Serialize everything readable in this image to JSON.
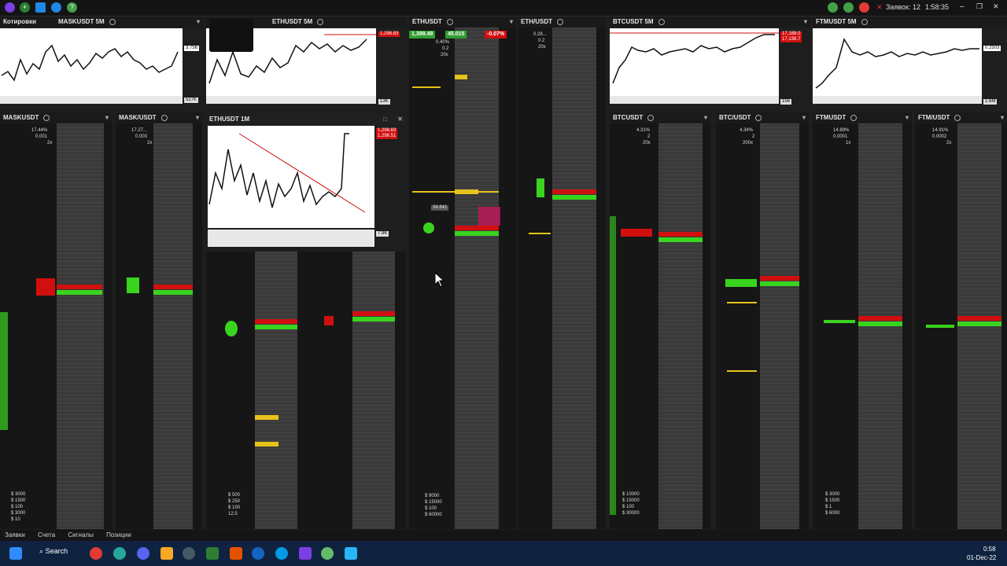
{
  "topbar": {
    "orders_label": "Заявок: 12",
    "time": "1:58:35"
  },
  "quotes_label": "Котировки",
  "charts_top": [
    {
      "title": "MASKUSDT 5M",
      "price_tag": "3.756",
      "vol_tag": "527K"
    },
    {
      "title": "ETHUSDT 5M",
      "price_tag": "1,298.83",
      "vol_tag": "13K"
    },
    {
      "title": "BTCUSDT 5M",
      "price_tag": "17,188.0",
      "price_tag2": "17,138.7",
      "vol_tag": "156"
    },
    {
      "title": "FTMUSDT 5M",
      "price_tag": "0.2503",
      "vol_tag": "1.6M"
    }
  ],
  "floating_chart": {
    "title": "ETHUSDT 1M",
    "price_tag": "1,298.83",
    "price_tag2": "1,298.51",
    "vol_tag": "7.9K"
  },
  "ladders": [
    {
      "title": "MASKUSDT",
      "pct": "17.44%",
      "tick": "0.001",
      "lev": "2x"
    },
    {
      "title": "MASK/USDT",
      "pct": "17.27...",
      "tick": "0.003",
      "lev": "2x"
    },
    {
      "title": "ETHUSDT",
      "pct": "0.40%",
      "tick": "0.2",
      "lev": "20x",
      "bid": "1,399.48",
      "ask": "45.015",
      "change": "-0.07%"
    },
    {
      "title": "ETH/USDT",
      "pct": "0.28...",
      "tick": "0.2",
      "lev": "20x"
    },
    {
      "title": "BTCUSDT",
      "pct": "4.31%",
      "tick": "2",
      "lev": "20x"
    },
    {
      "title": "BTC/USDT",
      "pct": "4.34%",
      "tick": "2",
      "lev": "200x"
    },
    {
      "title": "FTMUSDT",
      "pct": "14.89%",
      "tick": "0.0001",
      "lev": "1x"
    },
    {
      "title": "FTM/USDT",
      "pct": "14.91%",
      "tick": "0.0002",
      "lev": "2x"
    }
  ],
  "order_sizes": {
    "mask": [
      "$ 3000",
      "$ 1500",
      "$ 100",
      "$ 3000",
      "$ 10"
    ],
    "eth": [
      "$ 9000",
      "$ 15000",
      "$ 100",
      "$ 60000"
    ],
    "btc": [
      "$ 10000",
      "$ 15000",
      "$ 100",
      "$ 30000"
    ],
    "ftm": [
      "$ 3000",
      "$ 1500",
      "$ 1",
      "$ 6000"
    ],
    "small": [
      "$ 500",
      "$ 250",
      "$ 100",
      "12.5"
    ]
  },
  "eth_label": "34.641",
  "bottom_tabs": [
    "Заявки",
    "Счета",
    "Сигналы",
    "Позиции"
  ],
  "taskbar": {
    "search": "Search",
    "clock_time": "0:58",
    "clock_date": "01-Dec-22"
  },
  "colors": {
    "bid": "#39d41f",
    "ask": "#d10f0f",
    "highlight": "#e6c21b"
  }
}
